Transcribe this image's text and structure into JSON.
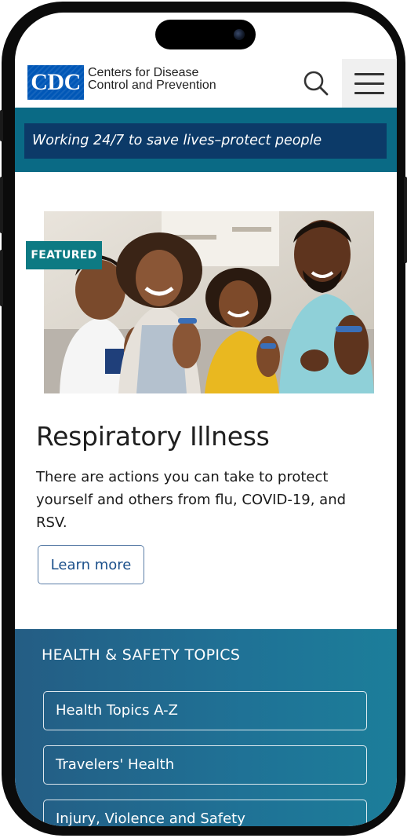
{
  "header": {
    "logo_text": "CDC",
    "org_name_line1": "Centers for Disease",
    "org_name_line2": "Control and Prevention"
  },
  "banner": {
    "tagline": "Working 24/7 to save lives–protect people"
  },
  "feature": {
    "badge": "FEATURED",
    "title": "Respiratory Illness",
    "description": "There are actions you can take to protect yourself and others from flu, COVID-19, and RSV.",
    "cta_label": "Learn more"
  },
  "topics": {
    "heading": "HEALTH & SAFETY TOPICS",
    "items": [
      {
        "label": "Health Topics A-Z"
      },
      {
        "label": "Travelers' Health"
      },
      {
        "label": "Injury, Violence and Safety"
      }
    ]
  },
  "colors": {
    "brand_blue": "#0057b7",
    "banner_teal": "#0a6a85",
    "banner_navy": "#0c3a68",
    "badge_teal": "#0d7a83",
    "topics_gradient_start": "#245d84",
    "topics_gradient_end": "#1c7e9a"
  },
  "icons": {
    "search": "search-icon",
    "menu": "hamburger-menu-icon"
  }
}
